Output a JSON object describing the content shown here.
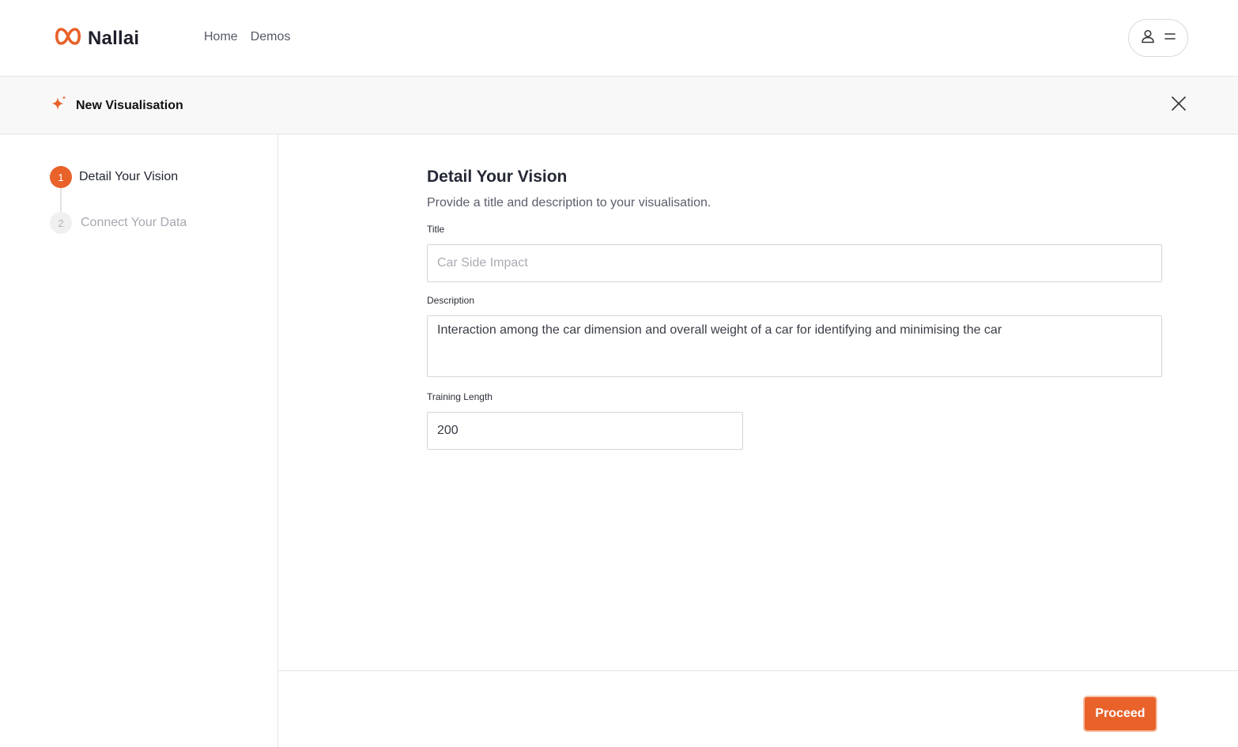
{
  "brand": {
    "name": "Nallai",
    "accent": "#e8622a"
  },
  "nav": {
    "items": [
      "Home",
      "Demos"
    ]
  },
  "header": {
    "title": "New Visualisation"
  },
  "steps": [
    {
      "number": "1",
      "label": "Detail Your Vision",
      "active": true
    },
    {
      "number": "2",
      "label": "Connect Your Data",
      "active": false
    }
  ],
  "form": {
    "heading": "Detail Your Vision",
    "subtitle": "Provide a title and description to your visualisation.",
    "title_label": "Title",
    "title_placeholder": "Car Side Impact",
    "title_value": "",
    "description_label": "Description",
    "description_value": "Interaction among the car dimension and overall weight of a car for identifying and minimising the car",
    "training_label": "Training Length",
    "training_value": "200"
  },
  "footer": {
    "proceed_label": "Proceed"
  },
  "icons": {
    "logo": "infinity-logo-icon",
    "user": "user-icon",
    "menu": "menu-icon",
    "sparkle": "sparkle-icon",
    "close": "close-icon"
  }
}
